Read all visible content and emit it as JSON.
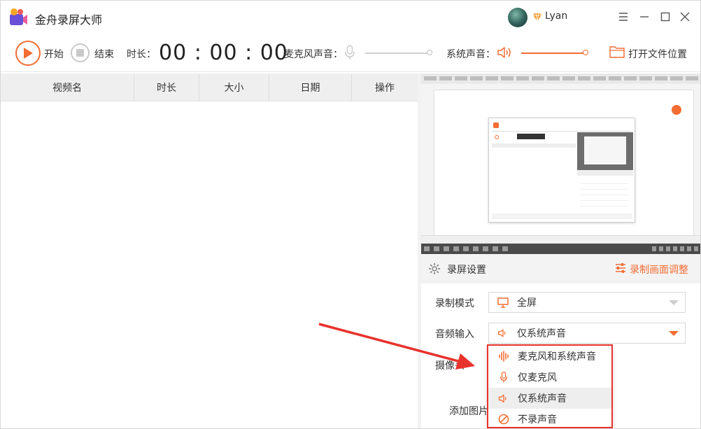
{
  "app": {
    "title": "金舟录屏大师"
  },
  "user": {
    "name": "Lyan"
  },
  "toolbar": {
    "start_label": "开始",
    "stop_label": "结束",
    "duration_label": "时长：",
    "timer": "00 : 00 : 00",
    "mic_label": "麦克风声音：",
    "system_label": "系统声音：",
    "open_folder_label": "打开文件位置"
  },
  "list": {
    "columns": [
      "视频名",
      "时长",
      "大小",
      "日期",
      "操作"
    ]
  },
  "settings": {
    "title": "录屏设置",
    "adjust_label": "录制画面调整",
    "record_mode_label": "录制模式",
    "record_mode_value": "全屏",
    "audio_input_label": "音频输入",
    "audio_input_value": "仅系统声音",
    "camera_label": "摄像头",
    "add_image_label": "添加图片"
  },
  "dropdown": {
    "items": [
      "麦克风和系统声音",
      "仅麦克风",
      "仅系统声音",
      "不录声音"
    ],
    "selected": "仅系统声音"
  },
  "colors": {
    "accent": "#f36d33",
    "highlight_box": "#e8322c",
    "arrow": "#e8322c"
  }
}
